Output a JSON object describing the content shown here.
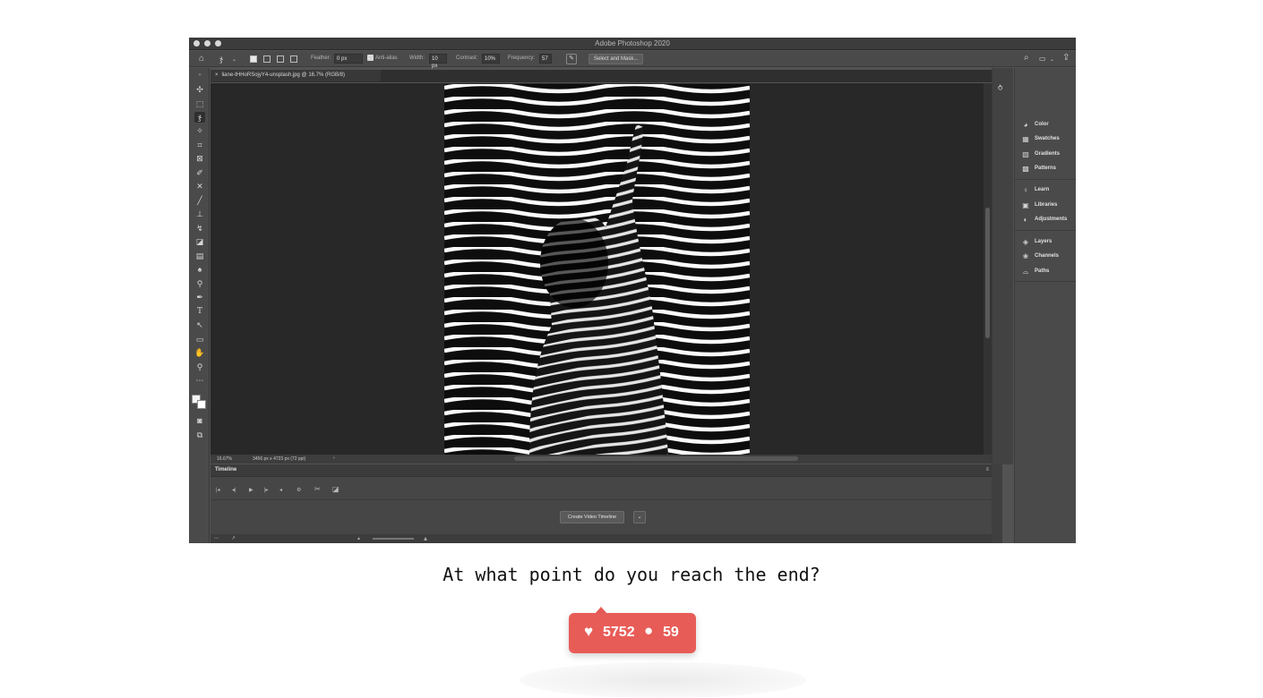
{
  "window": {
    "title": "Adobe Photoshop 2020"
  },
  "options_bar": {
    "feather_label": "Feather:",
    "feather_value": "0 px",
    "anti_alias_label": "Anti-alias",
    "width_label": "Width:",
    "width_value": "10 px",
    "contrast_label": "Contrast:",
    "contrast_value": "10%",
    "frequency_label": "Frequency:",
    "frequency_value": "57",
    "select_mask_label": "Select and Mask..."
  },
  "document": {
    "tab_label": "liane-tHHoRSojyY4-unsplash.jpg @ 16.7% (RGB/8)",
    "zoom": "16.67%",
    "dimensions": "3456 px x 4723 px (72 ppi)",
    "status_arrow": "›"
  },
  "timeline": {
    "tab_label": "Timeline",
    "create_button": "Create Video Timeline"
  },
  "panels": [
    {
      "label": "Color",
      "icon": "color-icon"
    },
    {
      "label": "Swatches",
      "icon": "swatches-icon"
    },
    {
      "label": "Gradients",
      "icon": "gradients-icon"
    },
    {
      "label": "Patterns",
      "icon": "patterns-icon"
    },
    {
      "label": "Learn",
      "icon": "learn-icon"
    },
    {
      "label": "Libraries",
      "icon": "libraries-icon"
    },
    {
      "label": "Adjustments",
      "icon": "adjustments-icon"
    },
    {
      "label": "Layers",
      "icon": "layers-icon"
    },
    {
      "label": "Channels",
      "icon": "channels-icon"
    },
    {
      "label": "Paths",
      "icon": "paths-icon"
    }
  ],
  "post": {
    "caption": "At what point do you reach the end?",
    "likes": "5752",
    "comments": "59",
    "badge_color": "#e85c57"
  }
}
